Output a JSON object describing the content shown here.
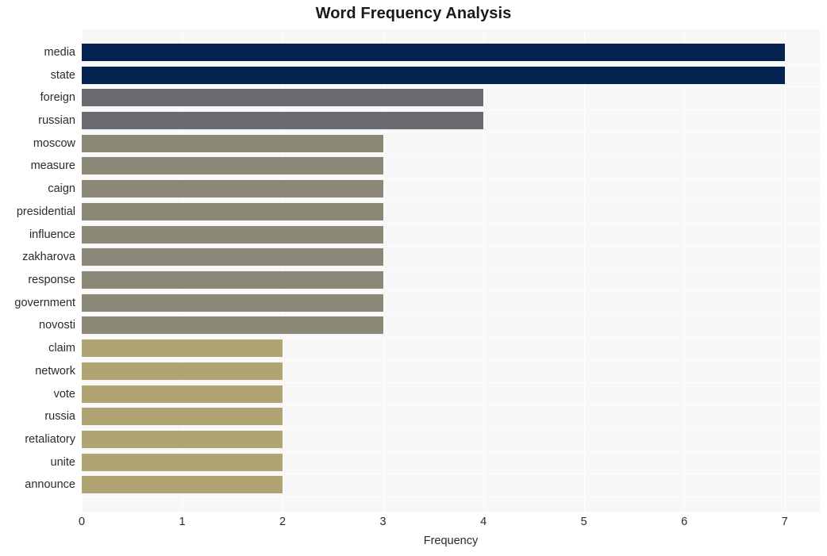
{
  "chart_data": {
    "type": "bar",
    "orientation": "horizontal",
    "title": "Word Frequency Analysis",
    "xlabel": "Frequency",
    "ylabel": "",
    "categories": [
      "media",
      "state",
      "foreign",
      "russian",
      "moscow",
      "measure",
      "caign",
      "presidential",
      "influence",
      "zakharova",
      "response",
      "government",
      "novosti",
      "claim",
      "network",
      "vote",
      "russia",
      "retaliatory",
      "unite",
      "announce"
    ],
    "values": [
      7,
      7,
      4,
      4,
      3,
      3,
      3,
      3,
      3,
      3,
      3,
      3,
      3,
      2,
      2,
      2,
      2,
      2,
      2,
      2
    ],
    "bar_colors": [
      "#042350",
      "#042350",
      "#6a6b70",
      "#6a6b70",
      "#8b8878",
      "#8b8878",
      "#8b8878",
      "#8b8878",
      "#8b8878",
      "#8b8878",
      "#8b8878",
      "#8b8878",
      "#8b8878",
      "#b0a472",
      "#b0a472",
      "#b0a472",
      "#b0a472",
      "#b0a472",
      "#b0a472",
      "#b0a472"
    ],
    "xticks": [
      "0",
      "1",
      "2",
      "3",
      "4",
      "5",
      "6",
      "7"
    ],
    "xlim": [
      0,
      7.35
    ],
    "grid": true,
    "legend": "none",
    "plot_background": "#f7f7f7",
    "gridline_color": "#ffffff",
    "figure_background": "#ffffff"
  }
}
